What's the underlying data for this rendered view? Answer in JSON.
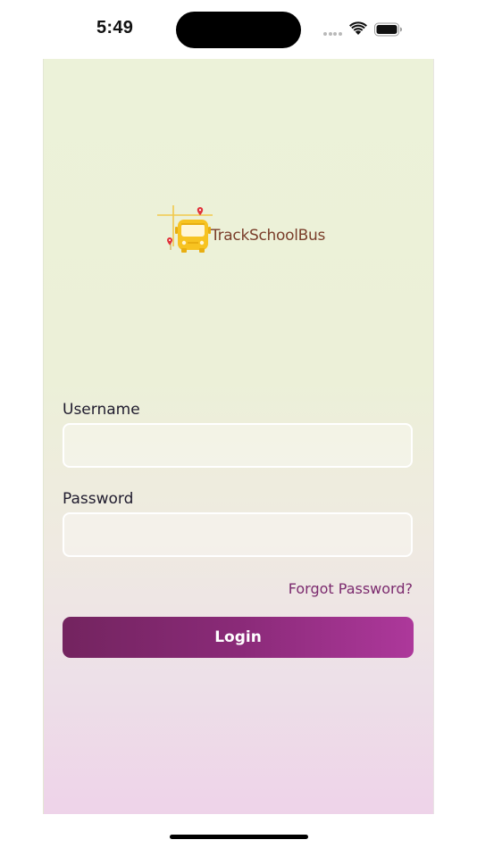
{
  "status_bar": {
    "time": "5:49"
  },
  "logo": {
    "text": "TrackSchoolBus",
    "bus_color": "#f7c321",
    "pin_color": "#e0323a",
    "road_color": "#f2c94c",
    "text_color": "#7a3e2a"
  },
  "login_form": {
    "username_label": "Username",
    "username_value": "",
    "password_label": "Password",
    "password_value": "",
    "forgot_password": "Forgot Password?",
    "login_button": "Login"
  },
  "colors": {
    "accent_start": "#73245f",
    "accent_end": "#ad389b",
    "link": "#7b2a6e",
    "label": "#1f1b2e"
  },
  "icons": [
    "wifi-icon",
    "battery-icon",
    "bus-icon",
    "map-pin-icon"
  ]
}
